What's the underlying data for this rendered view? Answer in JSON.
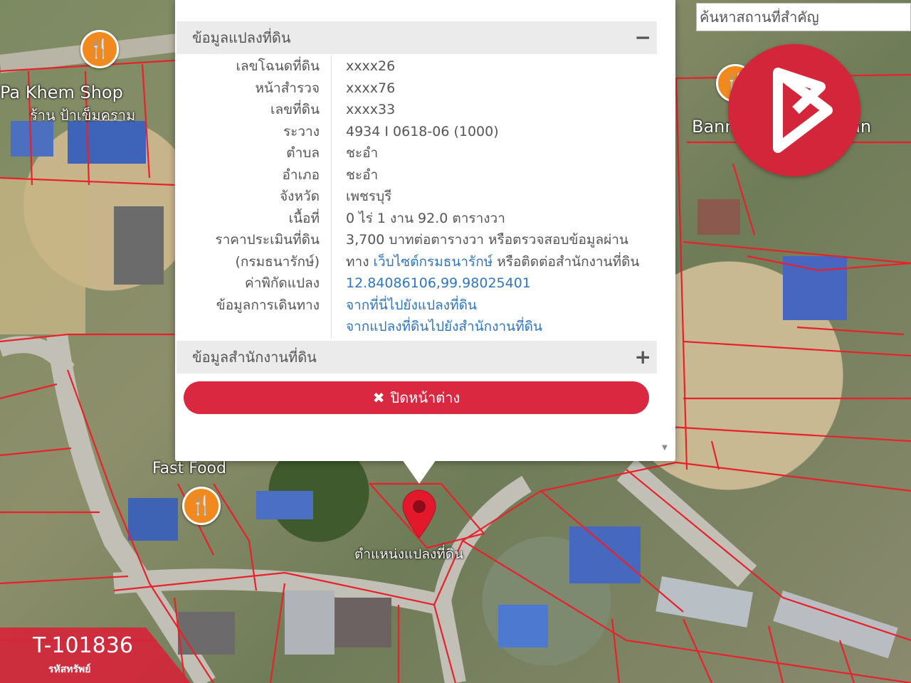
{
  "map": {
    "labels": {
      "shop_en": "Pa Khem Shop",
      "shop_th": "ร้าน ป้าเข็มคราม",
      "restaurant": "Bann Som Restauran",
      "fast_food": "Fast Food"
    },
    "marker_label": "ตำแหน่งแปลงที่ดิน",
    "parcel_line_color": "#e8212b"
  },
  "search": {
    "placeholder": "ค้นหาสถานที่สำคัญ"
  },
  "popup": {
    "section_land_title": "ข้อมูลแปลงที่ดิน",
    "section_land_toggle": "−",
    "section_office_title": "ข้อมูลสำนักงานที่ดิน",
    "section_office_toggle": "+",
    "rows": [
      {
        "key": "เลขโฉนดที่ดิน",
        "value": "xxxx26"
      },
      {
        "key": "หน้าสำรวจ",
        "value": "xxxx76"
      },
      {
        "key": "เลขที่ดิน",
        "value": "xxxx33"
      },
      {
        "key": "ระวาง",
        "value": "4934 I 0618-06 (1000)"
      },
      {
        "key": "ตำบล",
        "value": "ชะอำ"
      },
      {
        "key": "อำเภอ",
        "value": "ชะอำ"
      },
      {
        "key": "จังหวัด",
        "value": "เพชรบุรี"
      },
      {
        "key": "เนื้อที่",
        "value": "0 ไร่ 1 งาน 92.0 ตารางวา"
      }
    ],
    "appraisal": {
      "key1": "ราคาประเมินที่ดิน",
      "key2": "(กรมธนารักษ์)",
      "value1": "3,700 บาทต่อตารางวา หรือตรวจสอบข้อมูลผ่าน",
      "value2_pre": "ทาง ",
      "value2_link": "เว็บไซต์กรมธนารักษ์",
      "value2_post": " หรือติดต่อสำนักงานที่ดิน"
    },
    "coords": {
      "key": "ค่าพิกัดแปลง",
      "value": "12.84086106,99.98025401"
    },
    "directions": {
      "key": "ข้อมูลการเดินทาง",
      "link1": "จากที่นี่ไปยังแปลงที่ดิน",
      "link2": "จากแปลงที่ดินไปยังสำนักงานที่ดิน"
    },
    "close_label": "ปิดหน้าต่าง",
    "close_icon": "✖"
  },
  "badge": {
    "code": "T-101836",
    "sub": "รหัสทรัพย์",
    "color": "#d4263a"
  },
  "colors": {
    "accent": "#d9283f",
    "link": "#2f76c2"
  }
}
